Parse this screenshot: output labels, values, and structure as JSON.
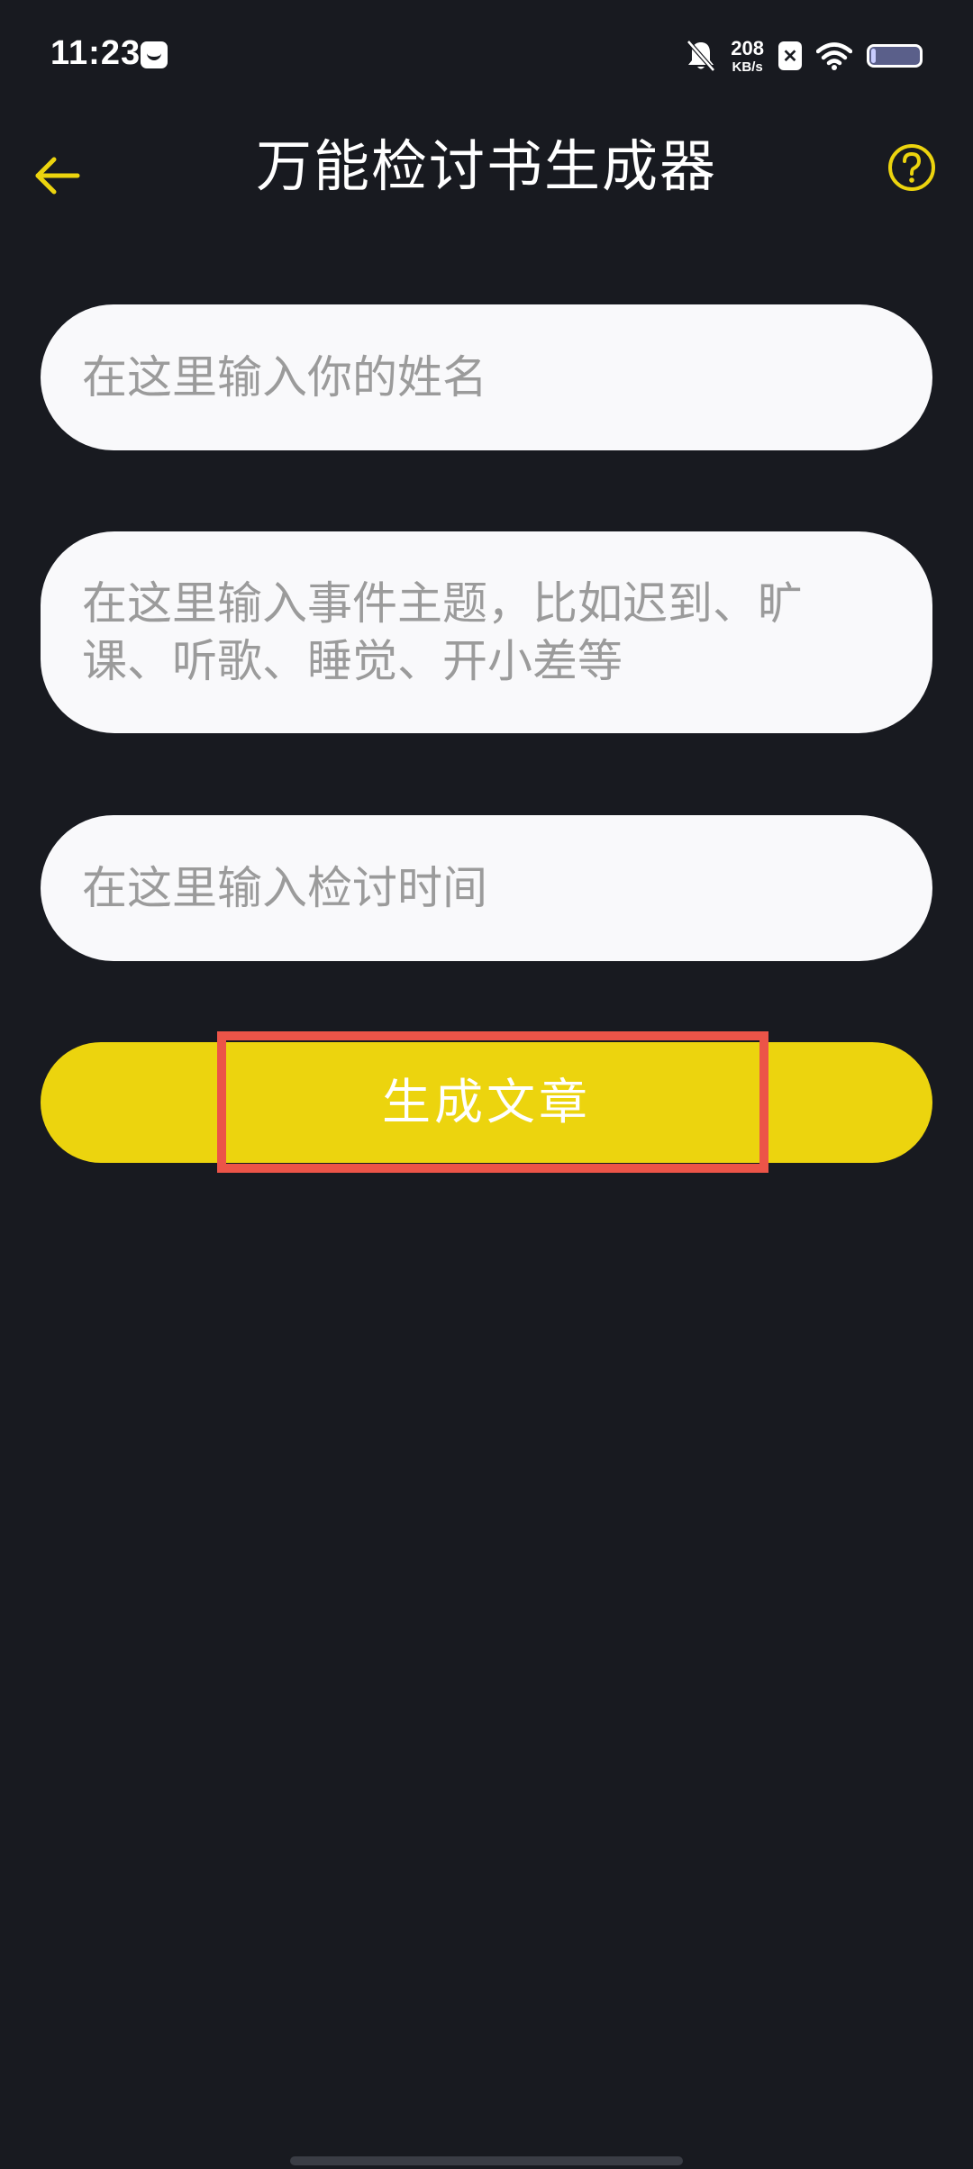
{
  "status_bar": {
    "time": "11:23",
    "net_speed_value": "208",
    "net_speed_unit": "KB/s",
    "sim_label": "✕",
    "icons": [
      "notification-icon",
      "mute-icon",
      "sim-x-icon",
      "wifi-icon",
      "battery-icon"
    ]
  },
  "header": {
    "title": "万能检讨书生成器",
    "back_icon": "arrow-left-icon",
    "help_icon": "question-circle-icon"
  },
  "form": {
    "name_placeholder": "在这里输入你的姓名",
    "name_value": "",
    "event_placeholder": "在这里输入事件主题，比如迟到、旷课、听歌、睡觉、开小差等",
    "event_value": "",
    "time_placeholder": "在这里输入检讨时间",
    "time_value": ""
  },
  "actions": {
    "generate_label": "生成文章"
  },
  "colors": {
    "background": "#181a20",
    "accent": "#ecd40e",
    "input_bg": "#f9f9fb",
    "placeholder": "#9b9b9b",
    "highlight": "#ec5448"
  }
}
